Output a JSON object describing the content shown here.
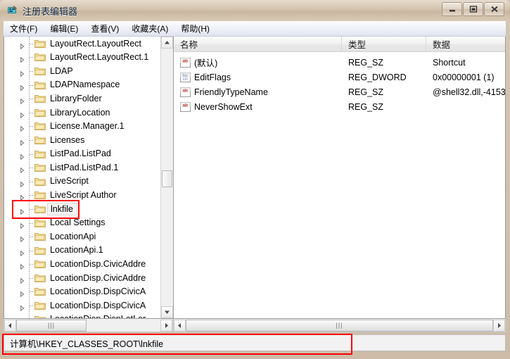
{
  "window": {
    "title": "注册表编辑器",
    "icon": "registry-editor-icon",
    "buttons": {
      "minimize": "最小化",
      "maximize": "最大化",
      "close": "关闭"
    }
  },
  "menubar": {
    "items": [
      {
        "label": "文件(F)"
      },
      {
        "label": "编辑(E)"
      },
      {
        "label": "查看(V)"
      },
      {
        "label": "收藏夹(A)"
      },
      {
        "label": "帮助(H)"
      }
    ]
  },
  "tree": {
    "items": [
      {
        "label": "LayoutRect.LayoutRect",
        "selected": false
      },
      {
        "label": "LayoutRect.LayoutRect.1",
        "selected": false
      },
      {
        "label": "LDAP",
        "selected": false
      },
      {
        "label": "LDAPNamespace",
        "selected": false
      },
      {
        "label": "LibraryFolder",
        "selected": false
      },
      {
        "label": "LibraryLocation",
        "selected": false
      },
      {
        "label": "License.Manager.1",
        "selected": false
      },
      {
        "label": "Licenses",
        "selected": false
      },
      {
        "label": "ListPad.ListPad",
        "selected": false
      },
      {
        "label": "ListPad.ListPad.1",
        "selected": false
      },
      {
        "label": "LiveScript",
        "selected": false
      },
      {
        "label": "LiveScript Author",
        "selected": false
      },
      {
        "label": "lnkfile",
        "selected": true
      },
      {
        "label": "Local Settings",
        "selected": false
      },
      {
        "label": "LocationApi",
        "selected": false
      },
      {
        "label": "LocationApi.1",
        "selected": false
      },
      {
        "label": "LocationDisp.CivicAddre",
        "selected": false
      },
      {
        "label": "LocationDisp.CivicAddre",
        "selected": false
      },
      {
        "label": "LocationDisp.DispCivicA",
        "selected": false
      },
      {
        "label": "LocationDisp.DispCivicA",
        "selected": false
      },
      {
        "label": "LocationDisp.DispLatLor",
        "selected": false
      }
    ]
  },
  "list": {
    "columns": [
      {
        "label": "名称"
      },
      {
        "label": "类型"
      },
      {
        "label": "数据"
      }
    ],
    "rows": [
      {
        "icon": "string-value-icon",
        "name": "(默认)",
        "type": "REG_SZ",
        "data": "Shortcut"
      },
      {
        "icon": "binary-value-icon",
        "name": "EditFlags",
        "type": "REG_DWORD",
        "data": "0x00000001 (1)"
      },
      {
        "icon": "string-value-icon",
        "name": "FriendlyTypeName",
        "type": "REG_SZ",
        "data": "@shell32.dll,-4153"
      },
      {
        "icon": "string-value-icon",
        "name": "NeverShowExt",
        "type": "REG_SZ",
        "data": ""
      }
    ]
  },
  "statusbar": {
    "path": "计算机\\HKEY_CLASSES_ROOT\\lnkfile"
  },
  "annotations": {
    "highlight_color": "#ff0000"
  }
}
